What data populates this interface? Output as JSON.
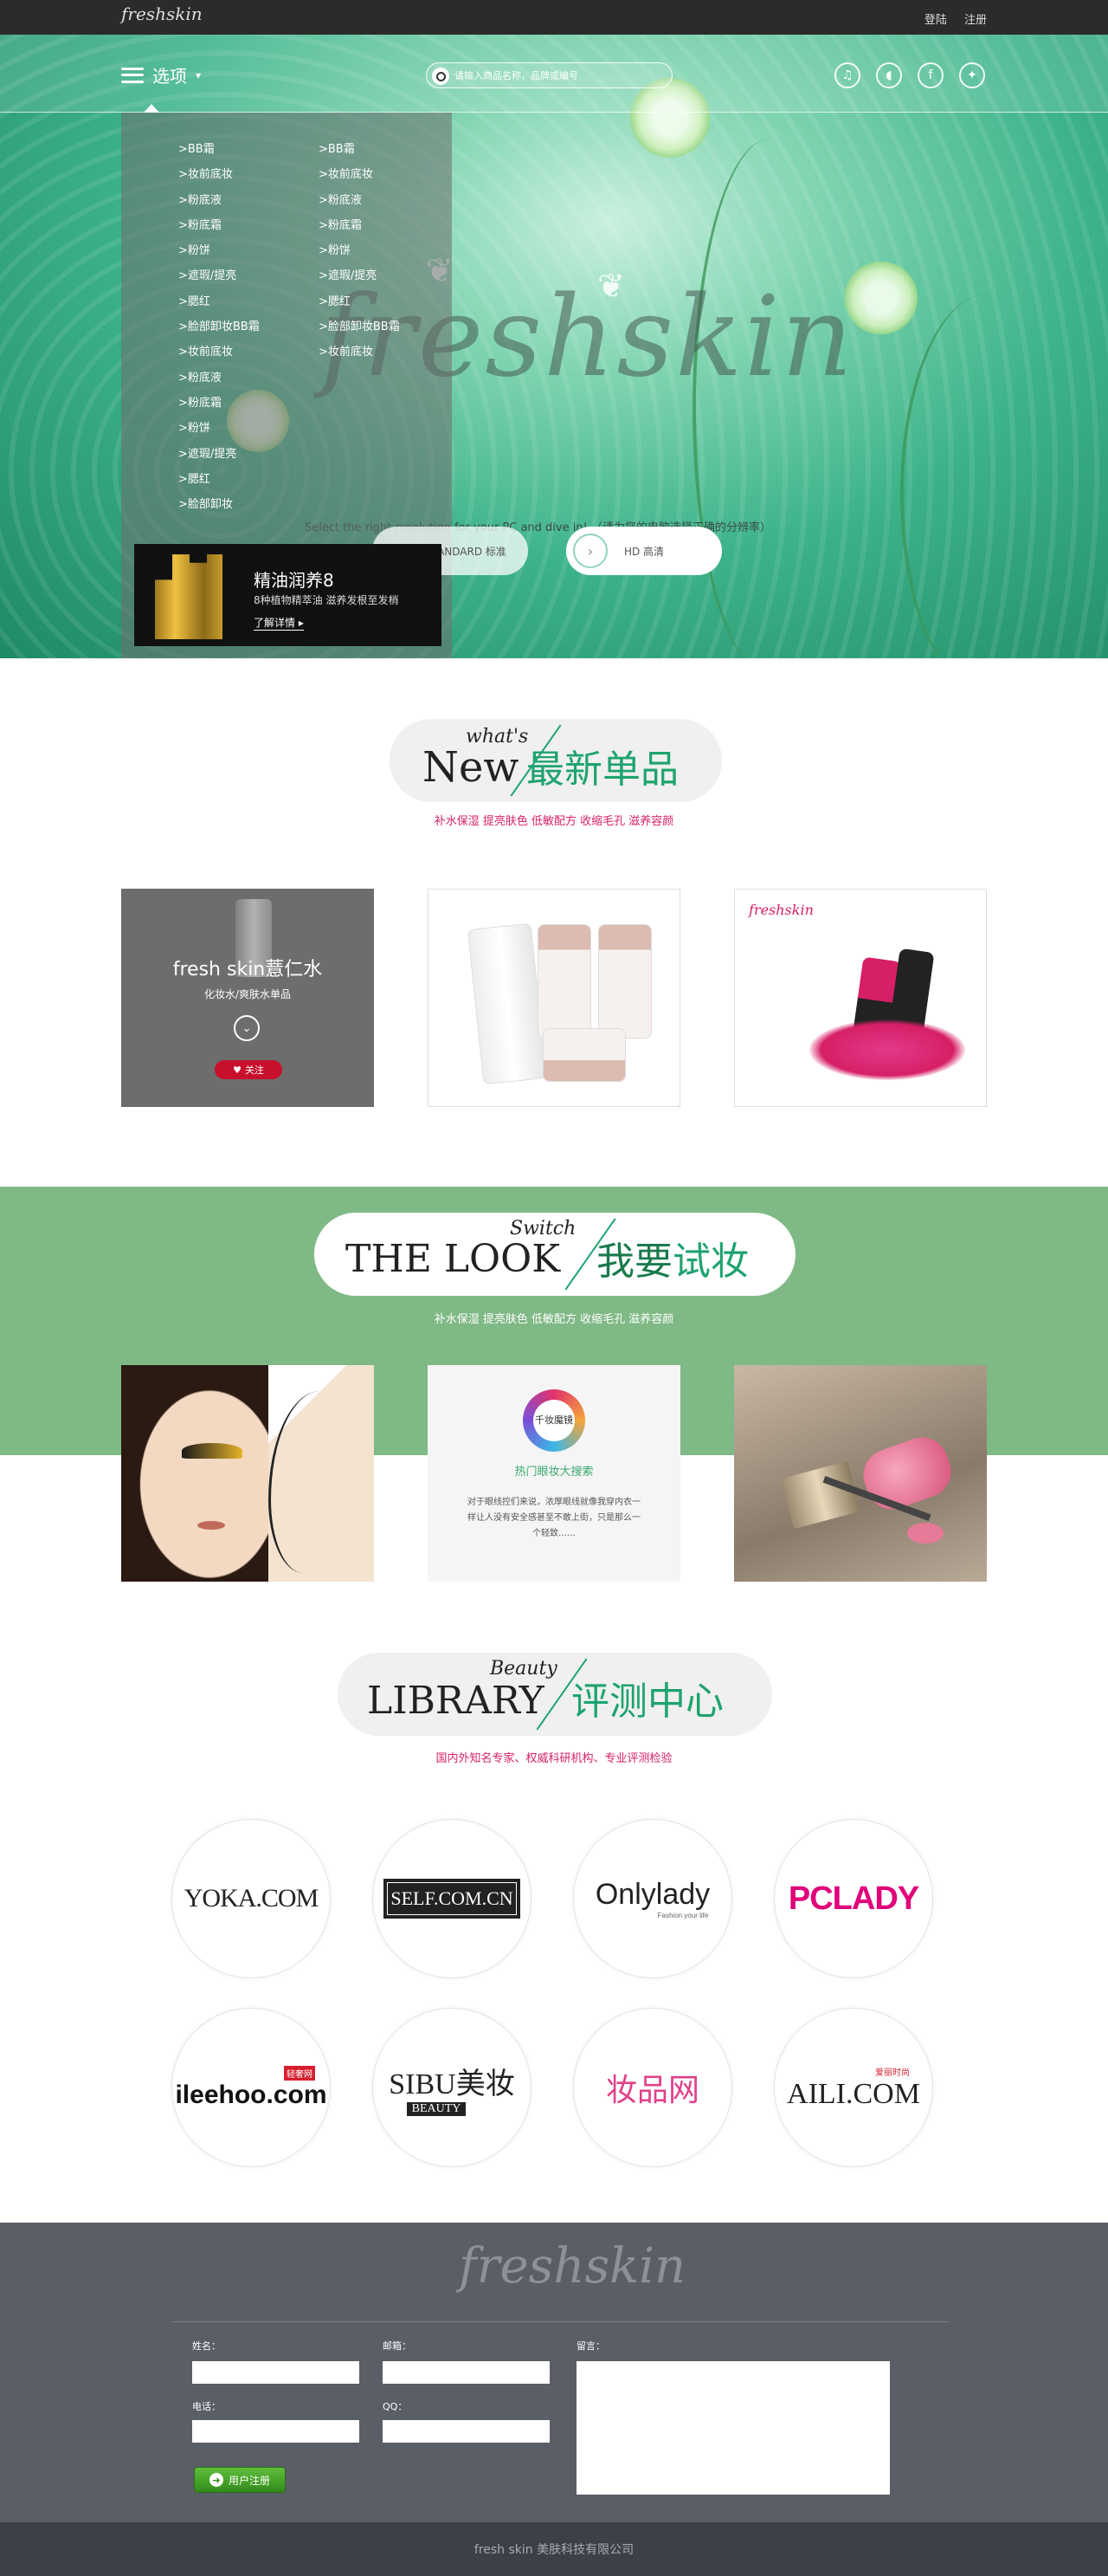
{
  "topbar": {
    "logo": "freshskin",
    "login": "登陆",
    "register": "注册"
  },
  "nav": {
    "menu_label": "选项",
    "menu_caret": "▾",
    "search_placeholder": "请输入商品名称，品牌或编号",
    "socials": [
      {
        "icon": "music-note-icon",
        "glyph": "♫"
      },
      {
        "icon": "speaker-icon",
        "glyph": "🔊"
      },
      {
        "icon": "facebook-icon",
        "glyph": "f"
      },
      {
        "icon": "twitter-icon",
        "glyph": "t"
      }
    ]
  },
  "dropdown": {
    "col1": [
      ">BB霜",
      ">妆前底妆",
      ">粉底液",
      ">粉底霜",
      ">粉饼",
      ">遮瑕/提亮",
      ">腮红",
      ">脸部卸妆BB霜",
      ">妆前底妆",
      ">粉底液",
      ">粉底霜",
      ">粉饼",
      ">遮瑕/提亮",
      ">腮红",
      ">脸部卸妆"
    ],
    "col2": [
      ">BB霜",
      ">妆前底妆",
      ">粉底液",
      ">粉底霜",
      ">粉饼",
      ">遮瑕/提亮",
      ">腮红",
      ">脸部卸妆BB霜",
      ">妆前底妆"
    ]
  },
  "hero": {
    "title": "freshskin",
    "subtitle": "Select the right resolution for your PC and dive in! （请为您的电脑选择正确的分辨率）",
    "btn_standard": "STANDARD 标准",
    "btn_hd": "HD 高清",
    "promo_title": "精油润养8",
    "promo_desc": "8种植物精萃油  滋养发根至发梢",
    "promo_link": "了解详情 ▸"
  },
  "new_section": {
    "small": "what's",
    "en": "New",
    "cn": "最新单品",
    "tagline": "补水保湿 提亮肤色 低敏配方 收缩毛孔 滋养容颜",
    "card1_title": "fresh skin薏仁水",
    "card1_desc": "化妆水/爽肤水单品",
    "card1_follow": "关注",
    "card3_logo": "freshskin"
  },
  "look_section": {
    "small": "Switch",
    "en": "THE LOOK",
    "cn_a": "我要",
    "cn_b": "试妆",
    "tagline": "补水保湿 提亮肤色 低敏配方 收缩毛孔 滋养容颜",
    "badge_text": "千妆魔镜",
    "card_title": "热门眼妆大搜索",
    "card_body": "对于眼线控们来说，浓厚眼线就像我穿内衣一样让人没有安全感甚至不敢上街，只是那么一个轻致……"
  },
  "library_section": {
    "small": "Beauty",
    "en": "LIBRARY",
    "cn": "评测中心",
    "tagline": "国内外知名专家、权威科研机构、专业评测检验",
    "brands": [
      {
        "name": "YOKA.COM"
      },
      {
        "name": "SELF.COM.CN"
      },
      {
        "name": "Onlylady",
        "sub": "Fashion your life"
      },
      {
        "name": "PCLADY"
      },
      {
        "name": "ileehoo.com",
        "sub": "轻奢网"
      },
      {
        "name": "SIBU美妆",
        "sub": "BEAUTY"
      },
      {
        "name": "妆品网"
      },
      {
        "name": "AILI.COM",
        "sub": "爱丽时尚"
      }
    ]
  },
  "footer": {
    "logo": "freshskin",
    "name_label": "姓名：",
    "email_label": "邮箱：",
    "message_label": "留言：",
    "phone_label": "电话：",
    "qq_label": "QQ：",
    "register_btn": "用户注册",
    "copyright": "fresh skin 美肤科技有限公司"
  },
  "colors": {
    "accent_green": "#1ea36e",
    "band_green": "#7fb985",
    "pink": "#d61f66",
    "footer": "#5a5e66"
  }
}
